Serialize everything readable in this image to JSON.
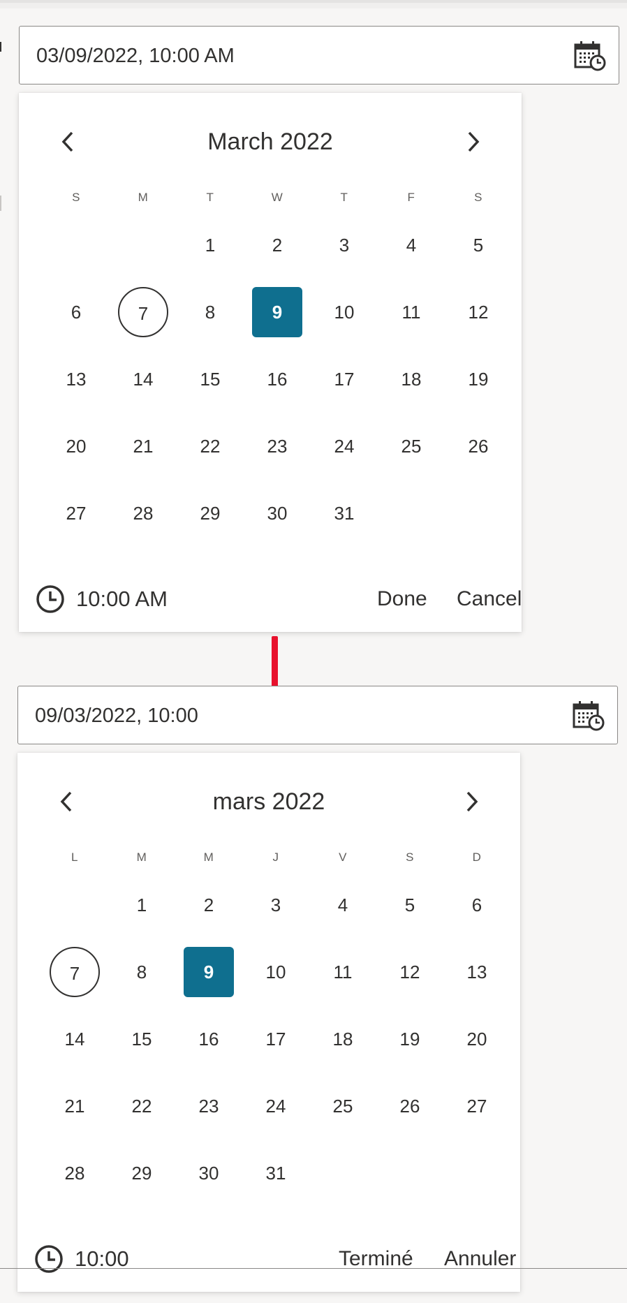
{
  "colors": {
    "selected_bg": "#0f6f8f",
    "divider": "#e8112d",
    "text": "#323130"
  },
  "pickers": [
    {
      "input_value": "03/09/2022, 10:00 AM",
      "month_label": "March 2022",
      "weekdays": [
        "S",
        "M",
        "T",
        "W",
        "T",
        "F",
        "S"
      ],
      "lead_blanks": 2,
      "days": [
        "1",
        "2",
        "3",
        "4",
        "5",
        "6",
        "7",
        "8",
        "9",
        "10",
        "11",
        "12",
        "13",
        "14",
        "15",
        "16",
        "17",
        "18",
        "19",
        "20",
        "21",
        "22",
        "23",
        "24",
        "25",
        "26",
        "27",
        "28",
        "29",
        "30",
        "31"
      ],
      "today": "7",
      "selected": "9",
      "time": "10:00 AM",
      "done_label": "Done",
      "cancel_label": "Cancel"
    },
    {
      "input_value": "09/03/2022, 10:00",
      "month_label": "mars 2022",
      "weekdays": [
        "L",
        "M",
        "M",
        "J",
        "V",
        "S",
        "D"
      ],
      "lead_blanks": 1,
      "days": [
        "1",
        "2",
        "3",
        "4",
        "5",
        "6",
        "7",
        "8",
        "9",
        "10",
        "11",
        "12",
        "13",
        "14",
        "15",
        "16",
        "17",
        "18",
        "19",
        "20",
        "21",
        "22",
        "23",
        "24",
        "25",
        "26",
        "27",
        "28",
        "29",
        "30",
        "31"
      ],
      "today": "7",
      "selected": "9",
      "time": "10:00",
      "done_label": "Terminé",
      "cancel_label": "Annuler"
    }
  ]
}
